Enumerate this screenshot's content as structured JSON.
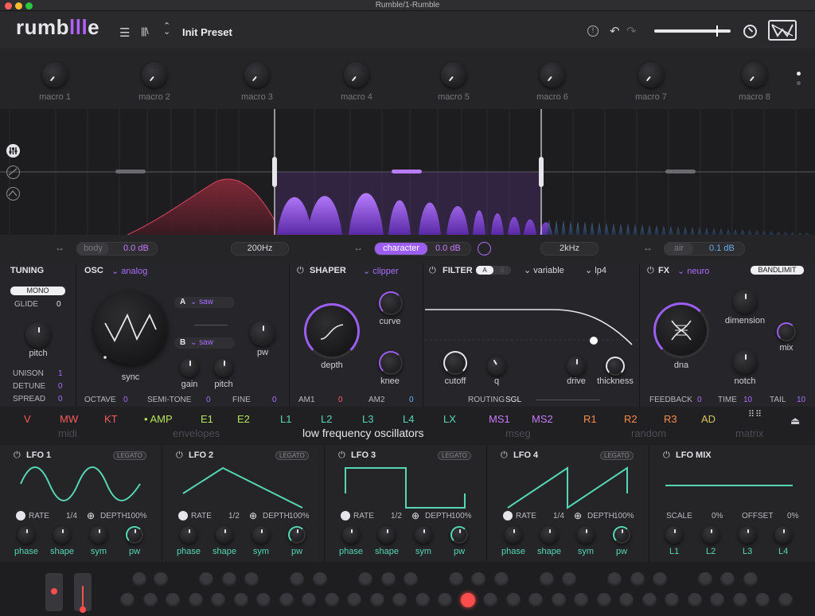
{
  "window": {
    "title": "Rumble/1-Rumble"
  },
  "header": {
    "logo_prefix": "rumb",
    "logo_bars": "lll",
    "logo_suffix": "e",
    "preset_name": "Init Preset"
  },
  "macros": [
    "macro 1",
    "macro 2",
    "macro 3",
    "macro 4",
    "macro 5",
    "macro 6",
    "macro 7",
    "macro 8"
  ],
  "bands": {
    "body": {
      "label": "body",
      "value": "0.0 dB"
    },
    "low_split": "200Hz",
    "character": {
      "label": "character",
      "value": "0.0 dB"
    },
    "high_split": "2kHz",
    "air": {
      "label": "air",
      "value": "0.1 dB"
    }
  },
  "tuning": {
    "title": "TUNING",
    "mode": "MONO",
    "glide_label": "GLIDE",
    "glide_value": "0",
    "pitch_label": "pitch",
    "unison_label": "UNISON",
    "unison_value": "1",
    "detune_label": "DETUNE",
    "detune_value": "0",
    "spread_label": "SPREAD",
    "spread_value": "0"
  },
  "osc": {
    "title": "OSC",
    "type": "analog",
    "sync_label": "sync",
    "a_label": "A",
    "a_wave": "saw",
    "b_label": "B",
    "b_wave": "saw",
    "gain_label": "gain",
    "pitch_label": "pitch",
    "pw_label": "pw",
    "octave_label": "OCTAVE",
    "octave_value": "0",
    "semitone_label": "SEMI-TONE",
    "semitone_value": "0",
    "fine_label": "FINE",
    "fine_value": "0"
  },
  "shaper": {
    "title": "SHAPER",
    "type": "clipper",
    "depth_label": "depth",
    "curve_label": "curve",
    "knee_label": "knee",
    "am1_label": "AM1",
    "am1_value": "0",
    "am2_label": "AM2",
    "am2_value": "0"
  },
  "filter": {
    "title": "FILTER",
    "ab_a": "A",
    "ab_b": "B",
    "type": "variable",
    "mode": "lp4",
    "cutoff_label": "cutoff",
    "q_label": "q",
    "drive_label": "drive",
    "thickness_label": "thickness",
    "routing_label": "ROUTING",
    "routing_value": "SGL"
  },
  "fx": {
    "title": "FX",
    "type": "neuro",
    "bandlimit": "BANDLIMIT",
    "dna_label": "dna",
    "dimension_label": "dimension",
    "mix_label": "mix",
    "notch_label": "notch",
    "feedback_label": "FEEDBACK",
    "feedback_value": "0",
    "time_label": "TIME",
    "time_value": "10",
    "tail_label": "TAIL",
    "tail_value": "10"
  },
  "mod_tabs": {
    "V": "V",
    "MW": "MW",
    "KT": "KT",
    "AMP": "AMP",
    "E1": "E1",
    "E2": "E2",
    "L1": "L1",
    "L2": "L2",
    "L3": "L3",
    "L4": "L4",
    "LX": "LX",
    "MS1": "MS1",
    "MS2": "MS2",
    "R1": "R1",
    "R2": "R2",
    "R3": "R3",
    "AD": "AD",
    "groups": {
      "midi": "midi",
      "envelopes": "envelopes",
      "lfo": "low frequency oscillators",
      "mseg": "mseg",
      "random": "random",
      "matrix": "matrix"
    }
  },
  "lfos": [
    {
      "title": "LFO 1",
      "legato": "LEGATO",
      "rate_label": "RATE",
      "rate": "1/4",
      "depth_label": "DEPTH",
      "depth": "100%",
      "k1": "phase",
      "k2": "shape",
      "k3": "sym",
      "k4": "pw"
    },
    {
      "title": "LFO 2",
      "legato": "LEGATO",
      "rate_label": "RATE",
      "rate": "1/2",
      "depth_label": "DEPTH",
      "depth": "100%",
      "k1": "phase",
      "k2": "shape",
      "k3": "sym",
      "k4": "pw"
    },
    {
      "title": "LFO 3",
      "legato": "LEGATO",
      "rate_label": "RATE",
      "rate": "1/2",
      "depth_label": "DEPTH",
      "depth": "100%",
      "k1": "phase",
      "k2": "shape",
      "k3": "sym",
      "k4": "pw"
    },
    {
      "title": "LFO 4",
      "legato": "LEGATO",
      "rate_label": "RATE",
      "rate": "1/4",
      "depth_label": "DEPTH",
      "depth": "100%",
      "k1": "phase",
      "k2": "shape",
      "k3": "sym",
      "k4": "pw"
    }
  ],
  "lfo_mix": {
    "title": "LFO MIX",
    "scale_label": "SCALE",
    "scale_value": "0%",
    "offset_label": "OFFSET",
    "offset_value": "0%",
    "k1": "L1",
    "k2": "L2",
    "k3": "L3",
    "k4": "L4"
  },
  "colors": {
    "accent": "#a86dff",
    "teal": "#55d6b4",
    "amp_green": "#b6e35a",
    "red": "#ff4d4d"
  }
}
